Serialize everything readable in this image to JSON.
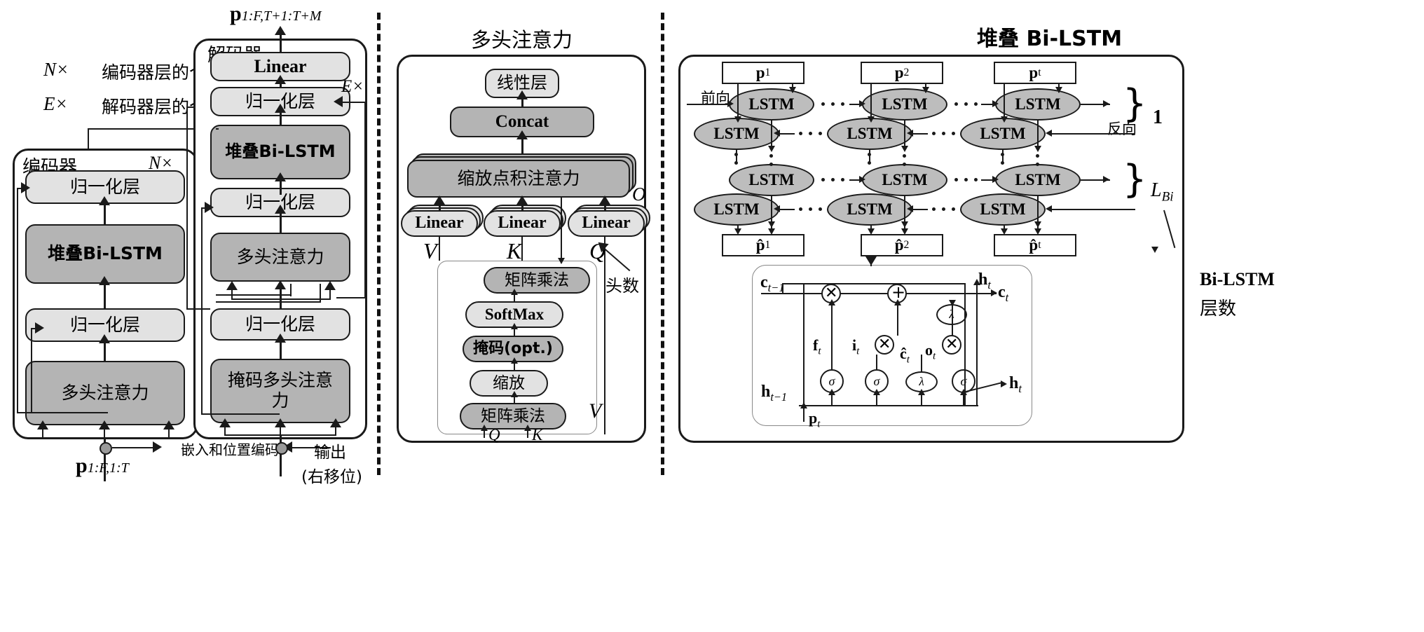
{
  "legend": {
    "n_symbol": "N×",
    "n_text": "编码器层的个数",
    "e_symbol": "E×",
    "e_text": "解码器层的个数"
  },
  "encoder": {
    "title": "编码器",
    "repeat": "N×",
    "blocks": [
      {
        "label": "归一化层",
        "style": "light"
      },
      {
        "label": "堆叠Bi-LSTM",
        "style": "dark"
      },
      {
        "label": "归一化层",
        "style": "light"
      },
      {
        "label": "多头注意力",
        "style": "dark"
      }
    ],
    "input_label": "p",
    "input_sub": "1:F,1:T"
  },
  "decoder": {
    "title": "解码器",
    "repeat": "E×",
    "output_label": "p",
    "output_sub": "1:F,T+1:T+M",
    "blocks": [
      {
        "label": "Linear",
        "style": "light"
      },
      {
        "label": "归一化层",
        "style": "light"
      },
      {
        "label": "堆叠Bi-LSTM",
        "style": "dark"
      },
      {
        "label": "归一化层",
        "style": "light"
      },
      {
        "label": "多头注意力",
        "style": "dark"
      },
      {
        "label": "归一化层",
        "style": "light"
      },
      {
        "label": "掩码多头注意力",
        "style": "dark"
      }
    ],
    "input_caption_line1": "输出",
    "input_caption_line2": "(右移位)"
  },
  "embedding_note": "嵌入和位置编码",
  "attention": {
    "title": "多头注意力",
    "blocks": [
      {
        "label": "线性层",
        "style": "light"
      },
      {
        "label": "Concat",
        "style": "dark"
      },
      {
        "label": "缩放点积注意力",
        "style": "dark"
      }
    ],
    "linear_label": "Linear",
    "inputs": [
      "V",
      "K",
      "Q"
    ],
    "head_marker": "O",
    "head_count_label": "头数",
    "sdpa": {
      "blocks": [
        {
          "label": "矩阵乘法",
          "style": "dark"
        },
        {
          "label": "SoftMax",
          "style": "light"
        },
        {
          "label": "掩码(opt.)",
          "style": "dark"
        },
        {
          "label": "缩放",
          "style": "light"
        },
        {
          "label": "矩阵乘法",
          "style": "dark"
        }
      ],
      "bottom_inputs": [
        "Q",
        "K"
      ],
      "side_input": "V"
    }
  },
  "bilstm": {
    "title": "堆叠 Bi-LSTM",
    "forward_label": "前向",
    "backward_label": "反向",
    "cell_label": "LSTM",
    "inputs": [
      {
        "label": "p",
        "sub": "1"
      },
      {
        "label": "p",
        "sub": "2"
      },
      {
        "label": "p",
        "sub": "t"
      }
    ],
    "outputs": [
      {
        "label": "p̂",
        "sub": "1"
      },
      {
        "label": "p̂",
        "sub": "2"
      },
      {
        "label": "p̂",
        "sub": "t"
      }
    ],
    "layer_first": "1",
    "layer_last": "L",
    "layer_last_sub": "Bi",
    "side_caption_line1": "Bi-LSTM",
    "side_caption_line2": "层数",
    "cell": {
      "c_prev": "c",
      "c_prev_sub": "t−1",
      "c_out": "c",
      "c_out_sub": "t",
      "h_top": "h",
      "h_top_sub": "t",
      "h_prev": "h",
      "h_prev_sub": "t−1",
      "h_out": "h",
      "h_out_sub": "t",
      "input": "p",
      "input_sub": "t",
      "gates": [
        {
          "name": "f",
          "sub": "t",
          "op": "σ"
        },
        {
          "name": "i",
          "sub": "t",
          "op": "σ"
        },
        {
          "name": "ĉ",
          "sub": "t",
          "op": "λ"
        },
        {
          "name": "o",
          "sub": "t",
          "op": "σ"
        }
      ],
      "ops": [
        "⊗",
        "⊕",
        "λ",
        "⊗",
        "⊗"
      ]
    }
  },
  "colors": {
    "light_fill": "#e2e2e2",
    "dark_fill": "#b4b4b4",
    "cell_fill": "#bdbdbd",
    "stroke": "#1a1a1a"
  }
}
